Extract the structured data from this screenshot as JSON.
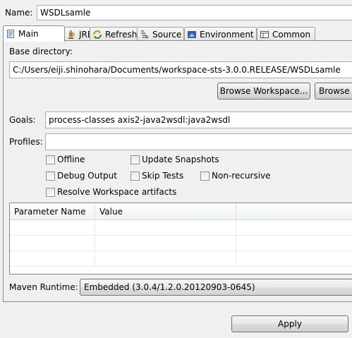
{
  "name": {
    "label": "Name:",
    "value": "WSDLsamle"
  },
  "tabs": [
    {
      "label": "Main",
      "icon": "main-tab-icon"
    },
    {
      "label": "JRE",
      "icon": "jre-icon"
    },
    {
      "label": "Refresh",
      "icon": "refresh-icon"
    },
    {
      "label": "Source",
      "icon": "source-icon"
    },
    {
      "label": "Environment",
      "icon": "environment-icon"
    },
    {
      "label": "Common",
      "icon": "common-icon"
    }
  ],
  "main": {
    "base_directory": {
      "label": "Base directory:",
      "value": "C:/Users/eiji.shinohara/Documents/workspace-sts-3.0.0.RELEASE/WSDLsamle"
    },
    "browse_workspace_label": "Browse Workspace...",
    "browse_label": "Browse",
    "goals": {
      "label": "Goals:",
      "value": "process-classes axis2-java2wsdl:java2wsdl"
    },
    "profiles": {
      "label": "Profiles:",
      "value": ""
    },
    "checkboxes": {
      "offline": "Offline",
      "update_snapshots": "Update Snapshots",
      "debug_output": "Debug Output",
      "skip_tests": "Skip Tests",
      "non_recursive": "Non-recursive",
      "resolve_workspace": "Resolve Workspace artifacts"
    },
    "params_table": {
      "columns": [
        "Parameter Name",
        "Value"
      ]
    },
    "maven_runtime": {
      "label": "Maven Runtime:",
      "value": "Embedded (3.0.4/1.2.0.20120903-0645)"
    }
  },
  "apply_label": "Apply"
}
